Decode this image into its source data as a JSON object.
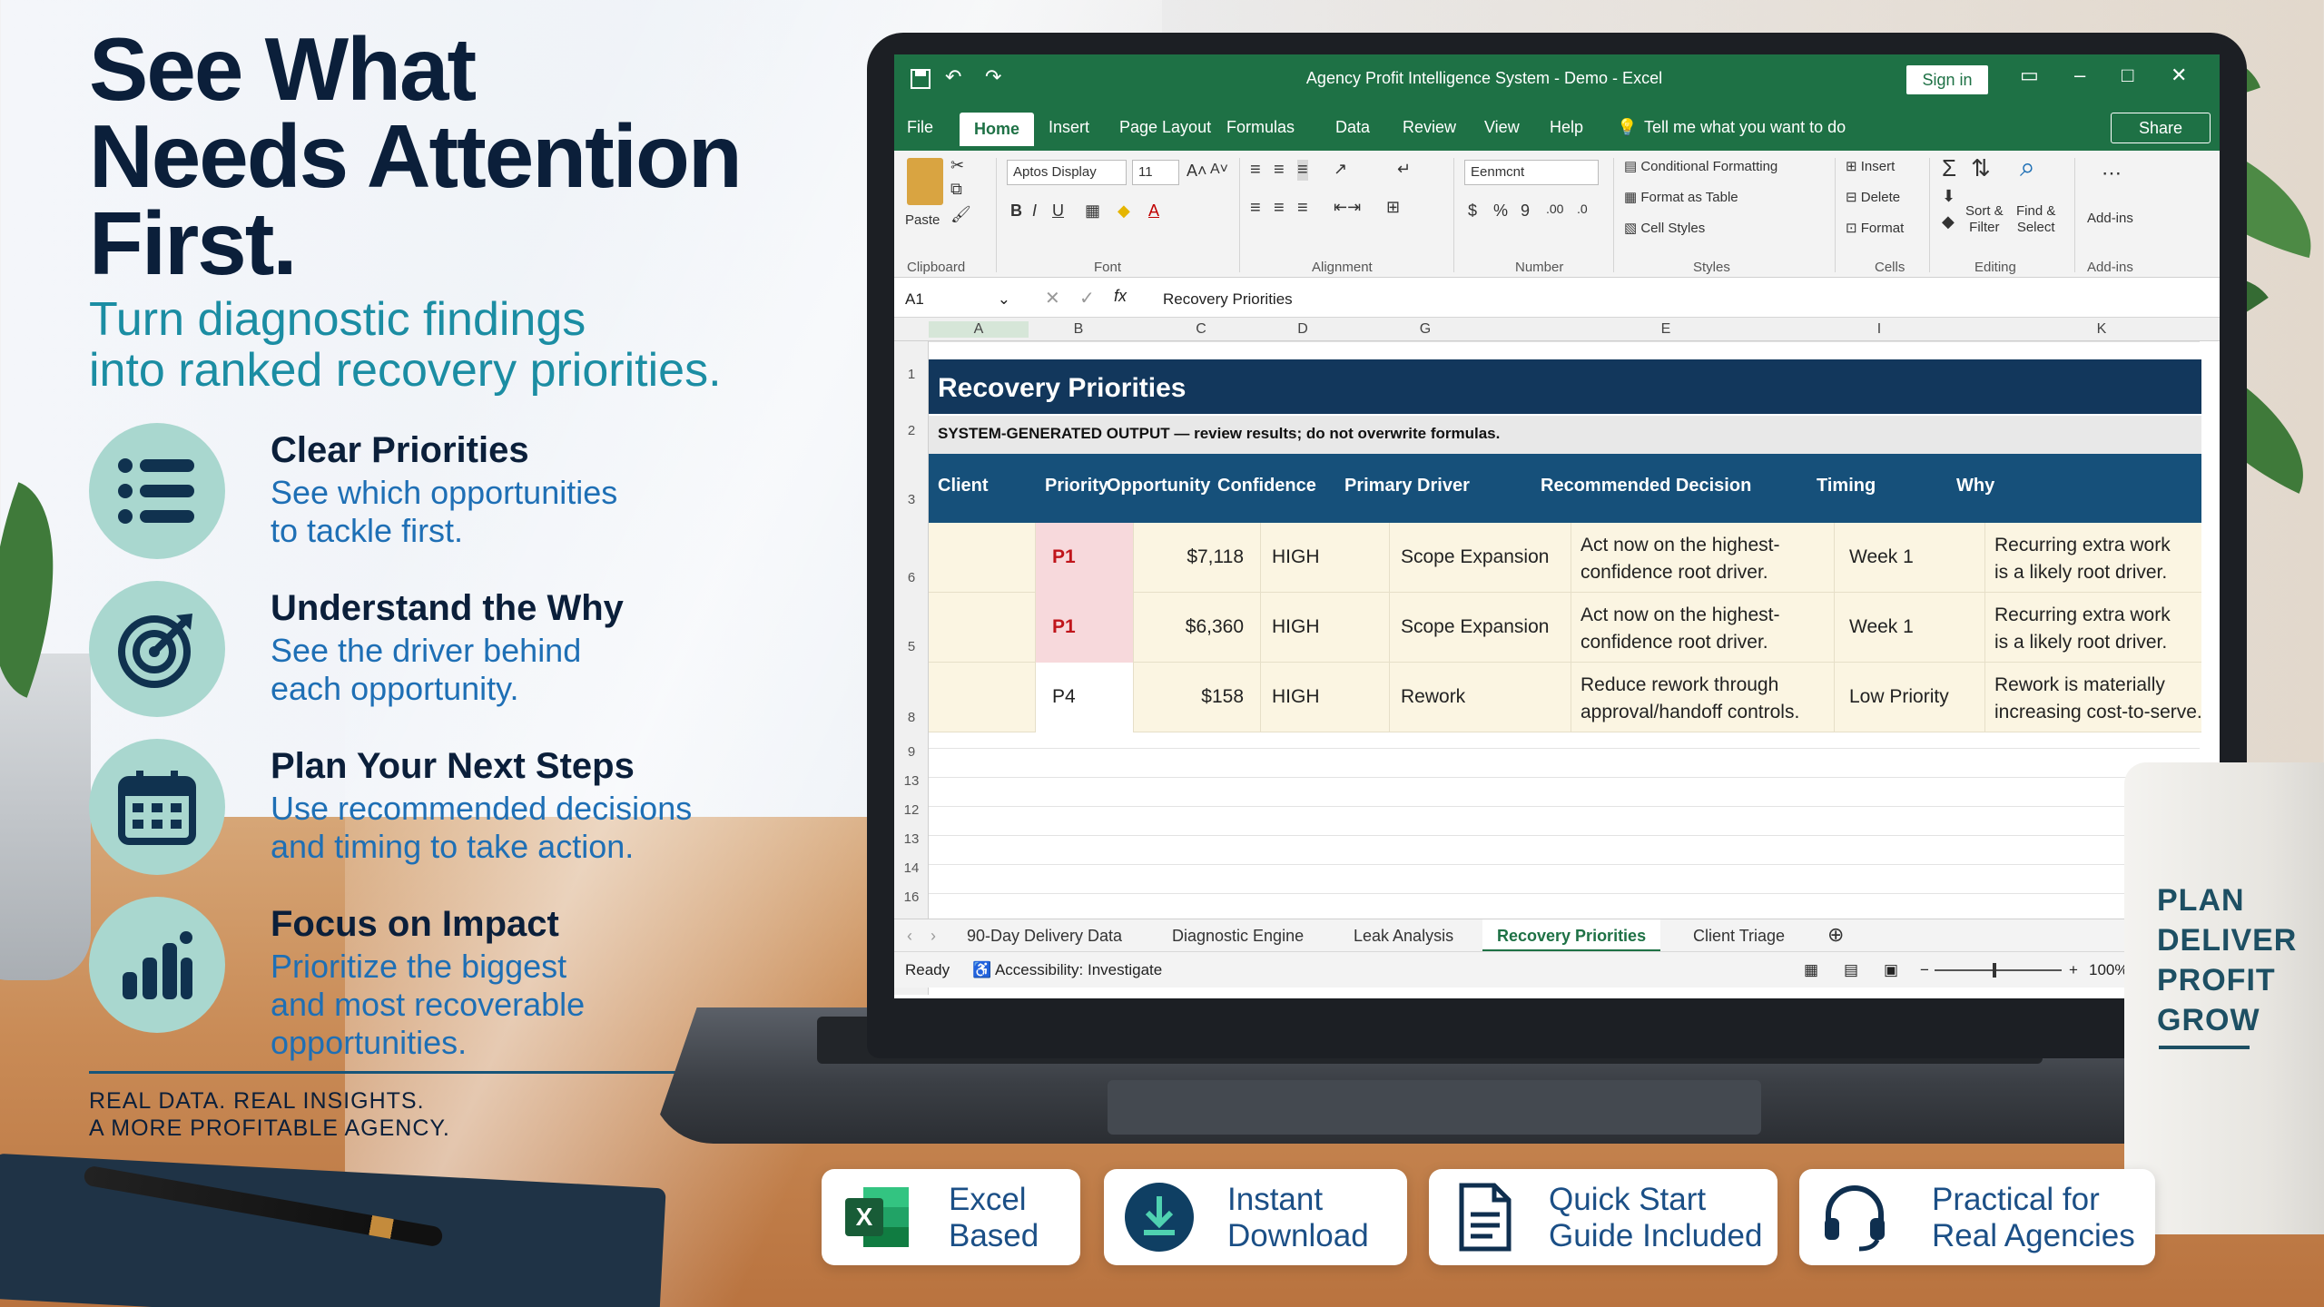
{
  "promo": {
    "headline": [
      "See What",
      "Needs Attention",
      "First."
    ],
    "subheadline": [
      "Turn diagnostic findings",
      "into ranked recovery priorities."
    ],
    "features": [
      {
        "icon": "list-icon",
        "title": "Clear Priorities",
        "desc": [
          "See which opportunities",
          "to tackle first."
        ]
      },
      {
        "icon": "target-icon",
        "title": "Understand the Why",
        "desc": [
          "See the driver behind",
          "each opportunity."
        ]
      },
      {
        "icon": "calendar-icon",
        "title": "Plan Your Next Steps",
        "desc": [
          "Use recommended decisions",
          "and timing to take action."
        ]
      },
      {
        "icon": "bar-chart-icon",
        "title": "Focus on Impact",
        "desc": [
          "Prioritize the biggest",
          "and most recoverable",
          "opportunities."
        ]
      }
    ],
    "tagline": [
      "REAL DATA. REAL INSIGHTS.",
      "A MORE PROFITABLE AGENCY."
    ]
  },
  "mug": {
    "lines": [
      "PLAN",
      "DELIVER",
      "PROFIT",
      "GROW"
    ]
  },
  "excel": {
    "window_title": "Agency Profit Intelligence System - Demo - Excel",
    "sign_in": "Sign in",
    "menu": [
      "File",
      "Home",
      "Insert",
      "Page Layout",
      "Formulas",
      "Data",
      "Review",
      "View",
      "Help"
    ],
    "tell_me": "Tell me what you want to do",
    "share": "Share",
    "ribbon": {
      "paste": "Paste",
      "font_name": "Aptos Display",
      "font_size": "11",
      "number_format": "Eenmcnt",
      "conditional_formatting": "Conditional Formatting",
      "format_as_table": "Format as Table",
      "cell_styles": "Cell Styles",
      "insert": "Insert",
      "delete": "Delete",
      "format": "Format",
      "sort_filter": [
        "Sort &",
        "Filter"
      ],
      "find_select": [
        "Find &",
        "Select"
      ],
      "addins": "Add-ins",
      "groups": [
        "Clipboard",
        "Font",
        "Alignment",
        "Number",
        "Styles",
        "Cells",
        "Editing",
        "Add-ins"
      ]
    },
    "name_box": "A1",
    "formula": "Recovery Priorities",
    "columns": [
      "A",
      "B",
      "C",
      "D",
      "G",
      "E",
      "I",
      "K"
    ],
    "row_numbers": [
      "1",
      "2",
      "3",
      "6",
      "5",
      "8",
      "9",
      "13",
      "12",
      "13",
      "14",
      "16"
    ],
    "sheet_title": "Recovery Priorities",
    "note": "SYSTEM-GENERATED OUTPUT — review results; do not overwrite formulas.",
    "headers": [
      "Client",
      "Priority",
      "Opportunity",
      "Confidence",
      "Primary Driver",
      "Recommended Decision",
      "Timing",
      "Why"
    ],
    "rows": [
      {
        "client": "",
        "priority": "P1",
        "opportunity": "$7,118",
        "confidence": "HIGH",
        "driver": "Scope Expansion",
        "decision": [
          "Act now on the highest-",
          "confidence root driver."
        ],
        "timing": "Week 1",
        "why": [
          "Recurring extra work",
          "is a likely root driver."
        ]
      },
      {
        "client": "",
        "priority": "P1",
        "opportunity": "$6,360",
        "confidence": "HIGH",
        "driver": "Scope Expansion",
        "decision": [
          "Act now on the highest-",
          "confidence root driver."
        ],
        "timing": "Week 1",
        "why": [
          "Recurring extra work",
          "is a likely root driver."
        ]
      },
      {
        "client": "",
        "priority": "P4",
        "opportunity": "$158",
        "confidence": "HIGH",
        "driver": "Rework",
        "decision": [
          "Reduce rework through",
          "approval/handoff controls."
        ],
        "timing": "Low Priority",
        "why": [
          "Rework is materially",
          "increasing cost-to-serve."
        ]
      }
    ],
    "sheet_tabs": [
      "90-Day Delivery Data",
      "Diagnostic Engine",
      "Leak Analysis",
      "Recovery Priorities",
      "Client Triage"
    ],
    "active_tab": "Recovery Priorities",
    "status_ready": "Ready",
    "status_accessibility": "Accessibility: Investigate",
    "zoom": "100%"
  },
  "badges": [
    {
      "icon": "excel-icon",
      "text": [
        "Excel",
        "Based"
      ]
    },
    {
      "icon": "download-icon",
      "text": [
        "Instant",
        "Download"
      ]
    },
    {
      "icon": "document-icon",
      "text": [
        "Quick Start",
        "Guide Included"
      ]
    },
    {
      "icon": "headset-icon",
      "text": [
        "Practical for",
        "Real Agencies"
      ]
    }
  ],
  "colors": {
    "navy": "#0b1f3a",
    "teal": "#1b8da3",
    "excel_green": "#1e7145",
    "table_header": "#16507a",
    "title_bar": "#12375c"
  }
}
